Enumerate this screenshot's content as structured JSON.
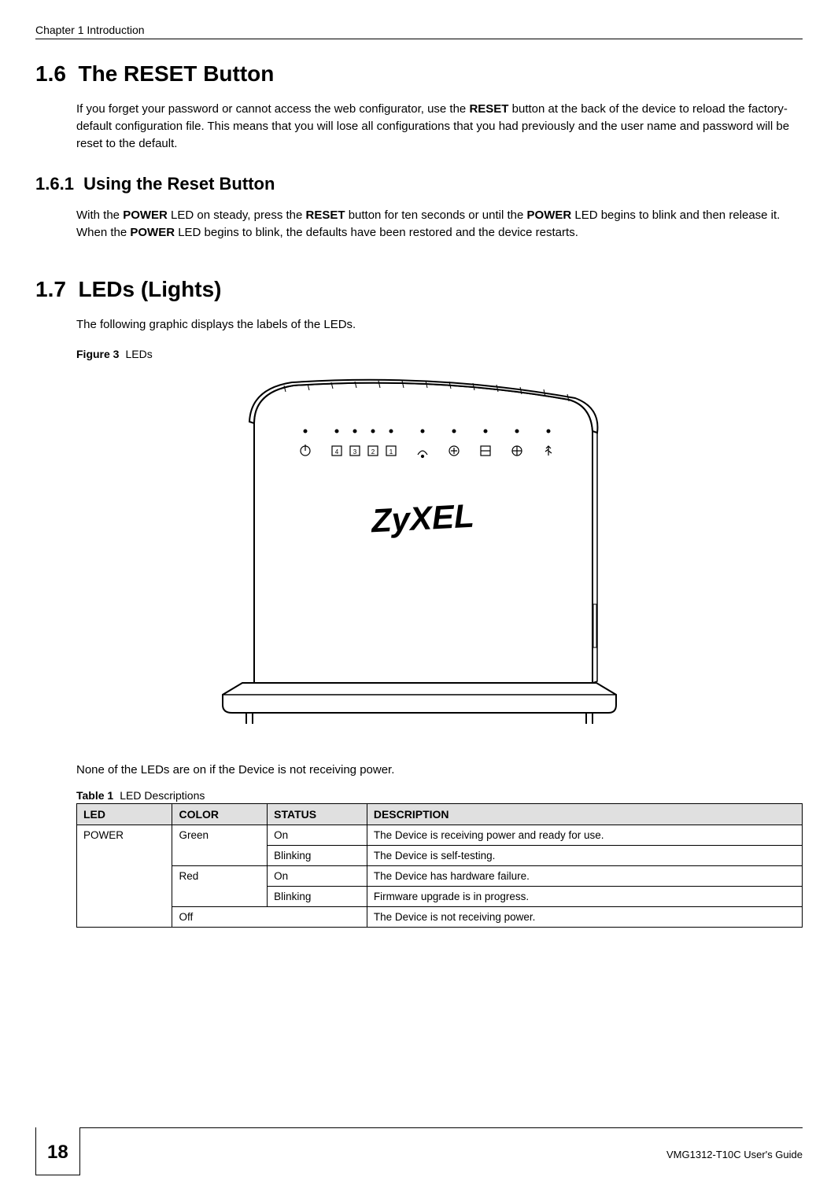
{
  "header": {
    "chapter": "Chapter 1 Introduction"
  },
  "sections": {
    "s1_6": {
      "number": "1.6",
      "title": "The RESET Button",
      "para_pre": "If you forget your password or cannot access the web configurator, use the ",
      "para_b1": "RESET",
      "para_post": " button at the back of the device to reload the factory-default configuration file. This means that you will lose all configurations that you had previously and the user name and password will be reset to the default."
    },
    "s1_6_1": {
      "number": "1.6.1",
      "title": "Using the Reset Button",
      "p1": "With the ",
      "b1": "POWER",
      "p2": " LED on steady, press the ",
      "b2": "RESET",
      "p3": " button for ten seconds or until the ",
      "b3": "POWER",
      "p4": " LED begins to blink and then release it. When the ",
      "b4": "POWER",
      "p5": " LED begins to blink, the defaults have been restored and the device restarts."
    },
    "s1_7": {
      "number": "1.7",
      "title": "LEDs (Lights)",
      "para": "The following graphic displays the labels of the LEDs.",
      "fig_label": "Figure 3",
      "fig_title": "LEDs",
      "post_fig": "None of the LEDs are on if the Device is not receiving power."
    }
  },
  "table": {
    "caption_label": "Table 1",
    "caption_title": "LED Descriptions",
    "headers": [
      "LED",
      "COLOR",
      "STATUS",
      "DESCRIPTION"
    ],
    "rows": [
      {
        "led": "POWER",
        "color": "Green",
        "status": "On",
        "desc": "The Device is receiving power and ready for use."
      },
      {
        "color": "",
        "status": "Blinking",
        "desc": "The Device is self-testing."
      },
      {
        "color": "Red",
        "status": "On",
        "desc": "The Device has hardware failure."
      },
      {
        "color": "",
        "status": "Blinking",
        "desc": "Firmware upgrade is in progress."
      },
      {
        "color_span": true,
        "status": "Off",
        "desc": "The Device is not receiving power."
      }
    ]
  },
  "footer": {
    "page": "18",
    "doc": "VMG1312-T10C User's Guide"
  },
  "device_brand": "ZyXEL"
}
